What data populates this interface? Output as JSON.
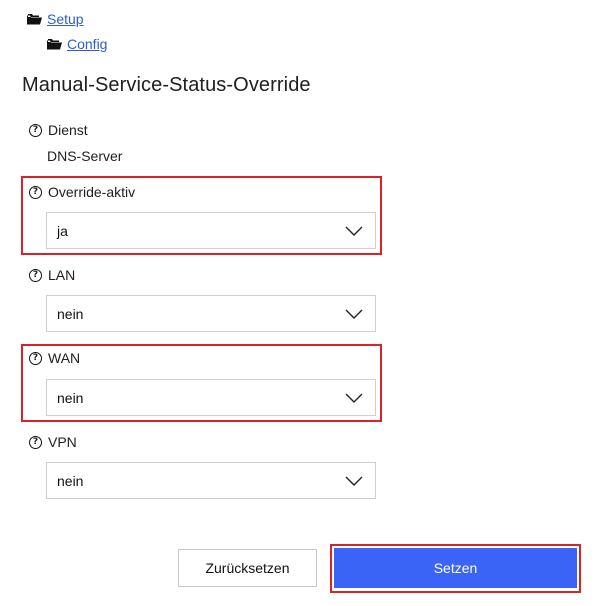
{
  "breadcrumb": [
    {
      "label": "Setup",
      "icon": "folder-icon"
    },
    {
      "label": "Config",
      "icon": "folder-icon"
    }
  ],
  "page_title": "Manual-Service-Status-Override",
  "fields": {
    "dienst": {
      "label": "Dienst",
      "value": "DNS-Server"
    },
    "override": {
      "label": "Override-aktiv",
      "value": "ja"
    },
    "lan": {
      "label": "LAN",
      "value": "nein"
    },
    "wan": {
      "label": "WAN",
      "value": "nein"
    },
    "vpn": {
      "label": "VPN",
      "value": "nein"
    }
  },
  "buttons": {
    "reset_label": "Zurücksetzen",
    "set_label": "Setzen"
  },
  "colors": {
    "accent": "#3a64f5",
    "highlight": "#d8232a",
    "link": "#2f5bd3"
  },
  "icons": {
    "help": "question-circle-icon",
    "dropdown": "chevron-down-icon"
  }
}
